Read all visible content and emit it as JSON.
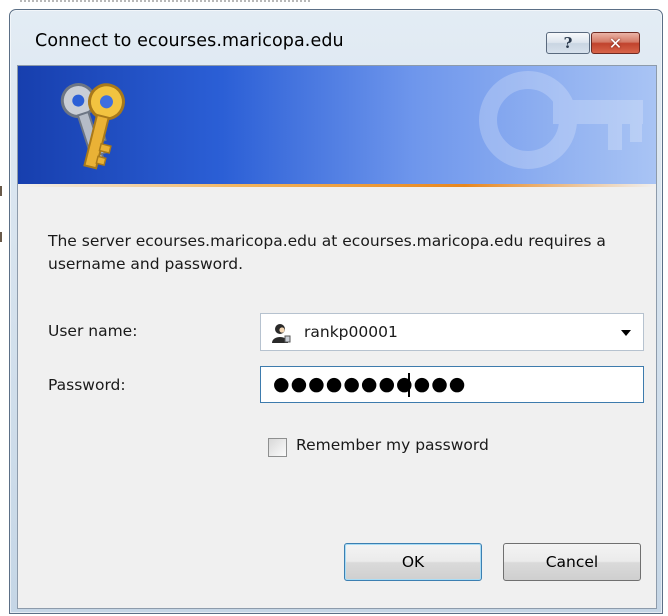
{
  "window": {
    "title": "Connect to ecourses.maricopa.edu",
    "help_glyph": "?",
    "close_glyph": "✕"
  },
  "icons": {
    "banner_icon": "keys-icon",
    "watermark": "keys-watermark-icon",
    "username_icon": "user-account-icon"
  },
  "dialog": {
    "message": "The server ecourses.maricopa.edu at ecourses.maricopa.edu requires a username and password.",
    "username_label": "User name:",
    "username_value": "rankp00001",
    "password_label": "Password:",
    "password_masked": "●●●●●●●●●●●",
    "remember_label": "Remember my password",
    "remember_checked": false,
    "ok_label": "OK",
    "cancel_label": "Cancel"
  },
  "colors": {
    "banner_start": "#173fae",
    "banner_end": "#a9c4f4",
    "accent_line": "#e8871e",
    "close_button": "#c0432d",
    "focus_border": "#3d7bad"
  }
}
